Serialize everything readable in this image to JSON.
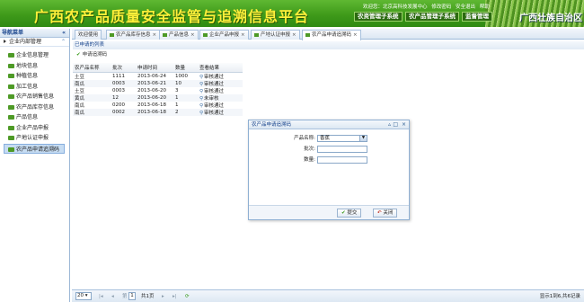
{
  "header": {
    "title": "广西农产品质量安全监管与追溯信息平台",
    "region": "广西壮族自治区",
    "top_links": [
      "欢迎您：北京高科技发展中心",
      "修改密码",
      "安全退出",
      "帮助"
    ],
    "system_buttons": [
      "农资管理子系统",
      "农产品管理子系统",
      "监督管理"
    ]
  },
  "sidebar": {
    "title": "导航菜单",
    "collapse_icon": "«",
    "group": "企业内部管理",
    "items": [
      "企业信息管理",
      "地块信息",
      "种植信息",
      "加工信息",
      "农产品销售信息",
      "农产品库存信息",
      "产品信息",
      "企业产品申报",
      "产地认证申报",
      "农产品申请追溯码"
    ],
    "active_index": 9
  },
  "tabs": [
    {
      "label": "欢迎使用",
      "closable": false
    },
    {
      "label": "农产品库存信息",
      "closable": true
    },
    {
      "label": "产品信息",
      "closable": true
    },
    {
      "label": "企业产品申报",
      "closable": true
    },
    {
      "label": "产地认证申报",
      "closable": true
    },
    {
      "label": "农产品申请追溯码",
      "closable": true
    }
  ],
  "panel": {
    "title": "已申请的列表",
    "toolbar_button": "申请追溯码"
  },
  "table": {
    "columns": [
      "农产品名称",
      "批次",
      "申请时间",
      "数量",
      "查看结果"
    ],
    "rows": [
      [
        "土豆",
        "1111",
        "2013-06-24",
        "1000",
        "审核通过"
      ],
      [
        "南瓜",
        "0003",
        "2013-06-21",
        "10",
        "审核通过"
      ],
      [
        "土豆",
        "0003",
        "2013-06-20",
        "3",
        "审核通过"
      ],
      [
        "黄瓜",
        "12",
        "2013-06-20",
        "1",
        "未审核"
      ],
      [
        "南瓜",
        "0200",
        "2013-06-18",
        "1",
        "审核通过"
      ],
      [
        "南瓜",
        "0002",
        "2013-06-18",
        "2",
        "审核通过"
      ]
    ]
  },
  "pager": {
    "page_size": "20",
    "page_label_pre": "第",
    "page_number": "1",
    "page_total": "共1页",
    "info": "显示1到6,共6记录"
  },
  "dialog": {
    "title": "农产品申请追溯码",
    "fields": [
      {
        "label": "产品名称:",
        "value": "香蕉",
        "type": "select"
      },
      {
        "label": "批次:",
        "value": "",
        "type": "text"
      },
      {
        "label": "数量:",
        "value": "",
        "type": "text"
      }
    ],
    "submit_label": "提交",
    "close_label": "关闭"
  },
  "colors": {
    "header_green": "#3f9a1a",
    "title_yellow": "#fff03a",
    "panel_blue": "#15428b"
  }
}
